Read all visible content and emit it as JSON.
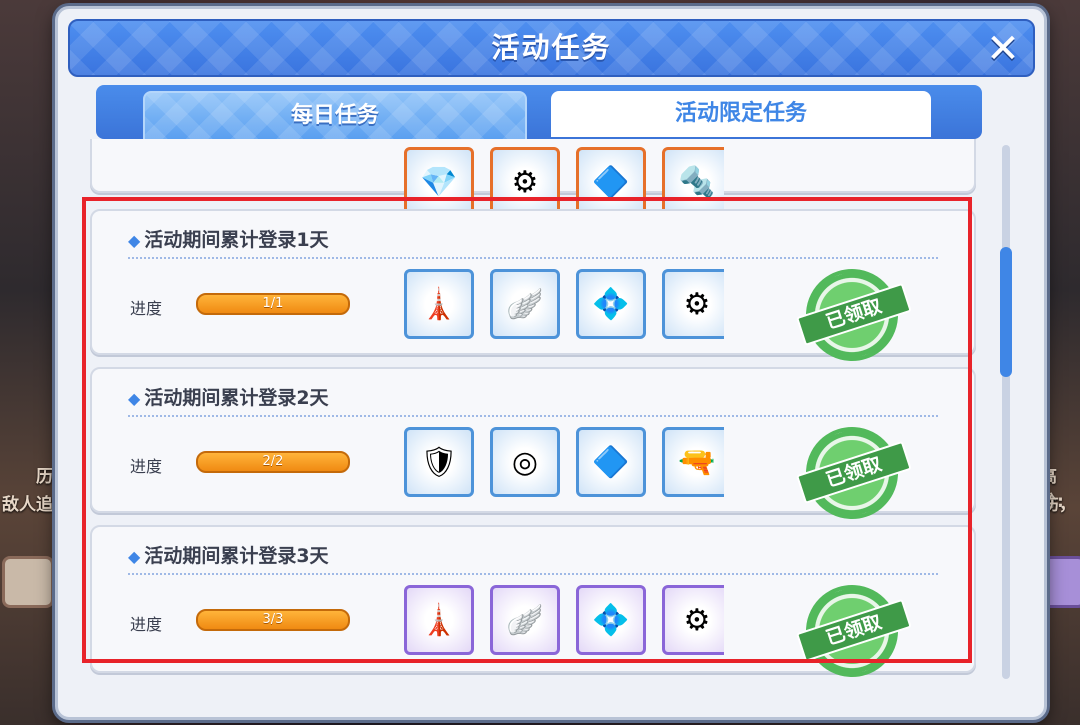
{
  "dialog": {
    "title": "活动任务",
    "close_icon": "✕"
  },
  "tabs": [
    {
      "label": "每日任务",
      "active": true
    },
    {
      "label": "活动限定任务",
      "active": false
    }
  ],
  "background": {
    "left_text_1": "历",
    "left_text_2": "敌人追",
    "right_text_1": "高分:",
    "right_text_2": "伤，"
  },
  "tasks": [
    {
      "title": "活动期间累计登录1天",
      "progress_label": "进度",
      "progress_text": "1/1",
      "progress_value": 1.0,
      "rewards": [
        "tower-icon",
        "wing-icon",
        "crystal-icon",
        "gear-icon"
      ],
      "status": "已领取"
    },
    {
      "title": "活动期间累计登录2天",
      "progress_label": "进度",
      "progress_text": "2/2",
      "progress_value": 1.0,
      "rewards": [
        "gem-shield-icon",
        "core-icon",
        "chip-icon",
        "cannon-icon"
      ],
      "status": "已领取"
    },
    {
      "title": "活动期间累计登录3天",
      "progress_label": "进度",
      "progress_text": "3/3",
      "progress_value": 1.0,
      "rewards": [
        "tower-icon",
        "wing-icon",
        "crystal-icon",
        "gear-icon"
      ],
      "status": "已领取"
    }
  ],
  "colors": {
    "accent": "#3f86e6",
    "highlight": "#e8232a",
    "progress": "#f08a12",
    "stamp": "#52b95b"
  }
}
